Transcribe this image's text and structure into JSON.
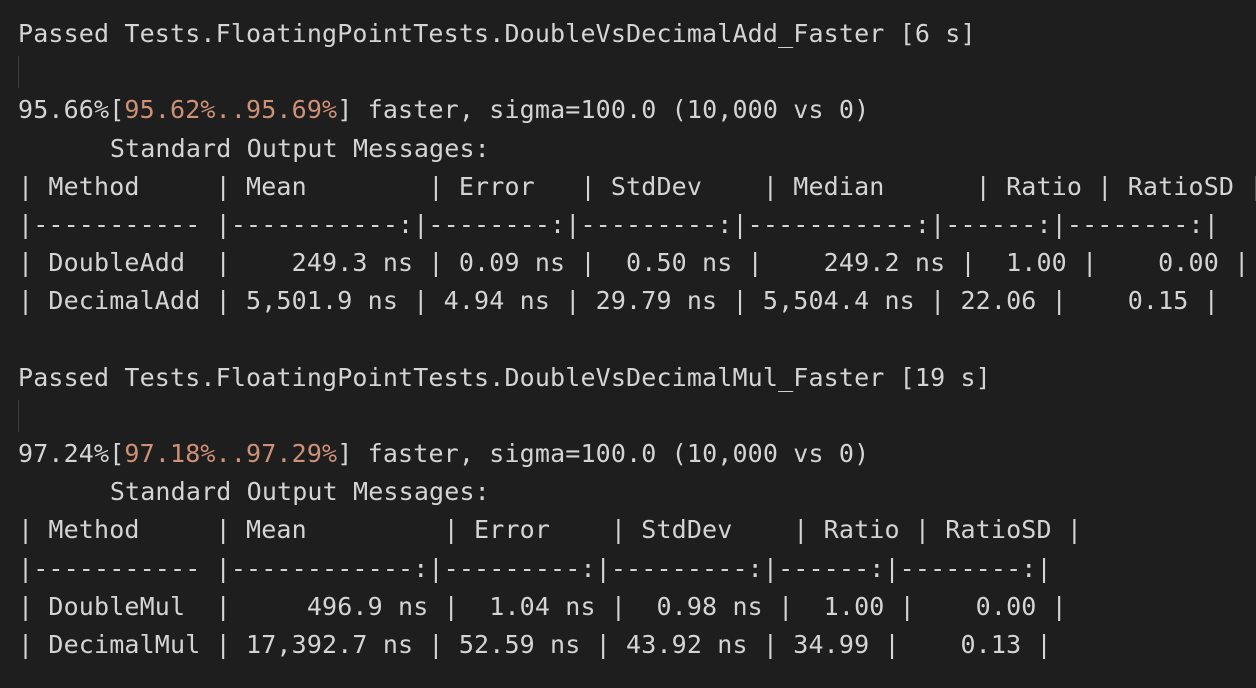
{
  "colors": {
    "background": "#1e1e1e",
    "foreground": "#d4d4d4",
    "confidence_interval": "#ce9178",
    "indent_guide": "#404040"
  },
  "blocks": [
    {
      "header": "Passed Tests.FloatingPointTests.DoubleVsDecimalAdd_Faster [6 s]",
      "output_label": "Standard Output Messages:",
      "summary": {
        "pct": "95.66%[",
        "ci": "95.62%..95.69%",
        "rest": "] faster, sigma=100.0 (10,000 vs 0)"
      },
      "table": {
        "header_row": "| Method     | Mean        | Error   | StdDev    | Median      | Ratio | RatioSD |",
        "separator_row": "|----------- |-----------:|--------:|---------:|-----------:|------:|--------:|",
        "rows": [
          "| DoubleAdd  |    249.3 ns | 0.09 ns |  0.50 ns |    249.2 ns |  1.00 |    0.00 |",
          "| DecimalAdd | 5,501.9 ns | 4.94 ns | 29.79 ns | 5,504.4 ns | 22.06 |    0.15 |"
        ]
      }
    },
    {
      "header": "Passed Tests.FloatingPointTests.DoubleVsDecimalMul_Faster [19 s]",
      "output_label": "Standard Output Messages:",
      "summary": {
        "pct": "97.24%[",
        "ci": "97.18%..97.29%",
        "rest": "] faster, sigma=100.0 (10,000 vs 0)"
      },
      "table": {
        "header_row": "| Method     | Mean         | Error    | StdDev    | Ratio | RatioSD |",
        "separator_row": "|----------- |------------:|---------:|---------:|------:|--------:|",
        "rows": [
          "| DoubleMul  |     496.9 ns |  1.04 ns |  0.98 ns |  1.00 |    0.00 |",
          "| DecimalMul | 17,392.7 ns | 52.59 ns | 43.92 ns | 34.99 |    0.13 |"
        ]
      }
    }
  ]
}
